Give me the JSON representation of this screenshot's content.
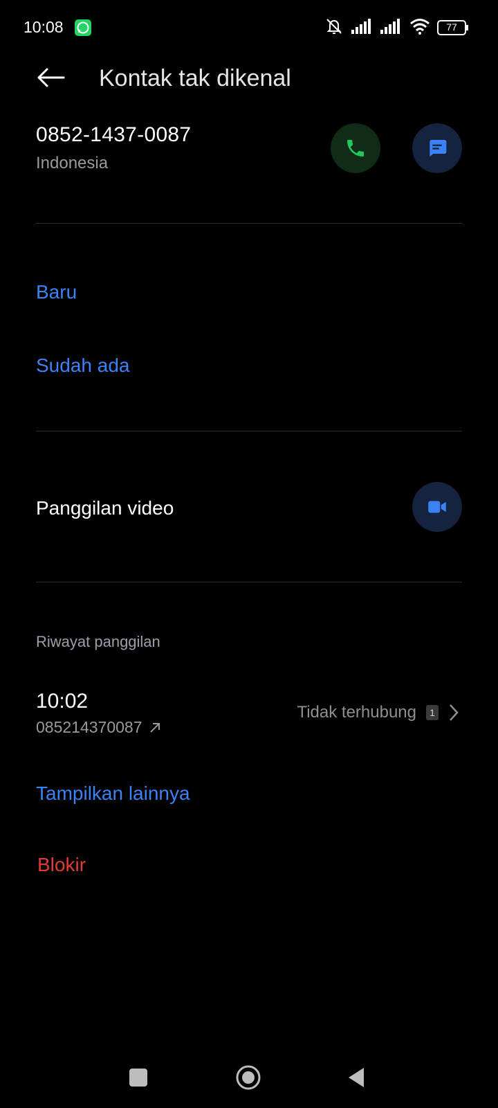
{
  "status_bar": {
    "time": "10:08",
    "battery": "77",
    "icons": [
      "whatsapp-icon",
      "mute-icon",
      "signal-icon",
      "signal-icon",
      "wifi-icon",
      "battery-icon"
    ]
  },
  "header": {
    "title": "Kontak tak dikenal",
    "back_icon": "arrow-left-icon"
  },
  "contact": {
    "number": "0852-1437-0087",
    "country": "Indonesia",
    "call_icon": "phone-icon",
    "message_icon": "message-icon"
  },
  "add_contact": {
    "new_label": "Baru",
    "existing_label": "Sudah ada"
  },
  "video": {
    "label": "Panggilan video",
    "icon": "video-camera-icon"
  },
  "history": {
    "title": "Riwayat panggilan",
    "entries": [
      {
        "time": "10:02",
        "number": "085214370087",
        "direction_icon": "outgoing-arrow-icon",
        "status": "Tidak terhubung",
        "sim": "1"
      }
    ],
    "show_more_label": "Tampilkan lainnya"
  },
  "block_label": "Blokir",
  "colors": {
    "accent_blue": "#3b82f6",
    "danger_red": "#e53935",
    "call_green": "#22c55e",
    "background": "#000000"
  },
  "nav_bar": {
    "icons": [
      "recents-square-icon",
      "home-circle-icon",
      "back-triangle-icon"
    ]
  }
}
